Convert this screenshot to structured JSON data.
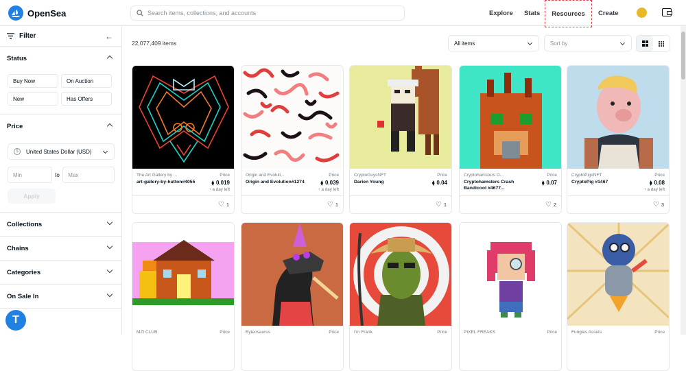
{
  "header": {
    "brand": "OpenSea",
    "search_placeholder": "Search items, collections, and accounts",
    "nav": [
      "Explore",
      "Stats",
      "Resources",
      "Create"
    ]
  },
  "sidebar": {
    "filter_label": "Filter",
    "status": {
      "title": "Status",
      "options": [
        "Buy Now",
        "On Auction",
        "New",
        "Has Offers"
      ]
    },
    "price": {
      "title": "Price",
      "currency": "United States Dollar (USD)",
      "currency_symbol": "$",
      "min_placeholder": "Min",
      "to_label": "to",
      "max_placeholder": "Max",
      "apply_label": "Apply"
    },
    "collapsed_sections": [
      "Collections",
      "Chains",
      "Categories",
      "On Sale In"
    ],
    "help_glyph": "T"
  },
  "main": {
    "item_count": "22,077,409 items",
    "filter_select": "All items",
    "sort_select": "Sort by",
    "cards_row1": [
      {
        "collection": "The Art Gallery by ...",
        "name": "art-gallery-by-hutton#4055",
        "price_label": "Price",
        "price": "0.019",
        "time_left": "a day left",
        "likes": "1"
      },
      {
        "collection": "Origin and Evoluti...",
        "name": "Origin and Evolution#1274",
        "price_label": "Price",
        "price": "0.039",
        "time_left": "a day left",
        "likes": "1"
      },
      {
        "collection": "CryptoGuysNFT",
        "name": "Darien Young",
        "price_label": "Price",
        "price": "0.04",
        "time_left": "",
        "likes": "1"
      },
      {
        "collection": "Cryptohamsters O...",
        "name": "Cryptohamsters Crash Bandicoot #4677...",
        "price_label": "Price",
        "price": "0.07",
        "time_left": "",
        "likes": "2"
      },
      {
        "collection": "CryptoPigsNFT",
        "name": "CryptoPig #1467",
        "price_label": "Price",
        "price": "0.08",
        "time_left": "a day left",
        "likes": "3"
      }
    ],
    "cards_row2": [
      {
        "collection": "MZI CLUB",
        "price_label": "Price"
      },
      {
        "collection": "Byteosaurus",
        "price_label": "Price"
      },
      {
        "collection": "I'm Frank",
        "price_label": "Price"
      },
      {
        "collection": "PIXEL FREAKS",
        "price_label": "Price"
      },
      {
        "collection": "Fungles Assets",
        "price_label": "Price"
      }
    ],
    "eth_symbol": "⧫",
    "clock_symbol": "◔",
    "heart_symbol": "♡"
  }
}
